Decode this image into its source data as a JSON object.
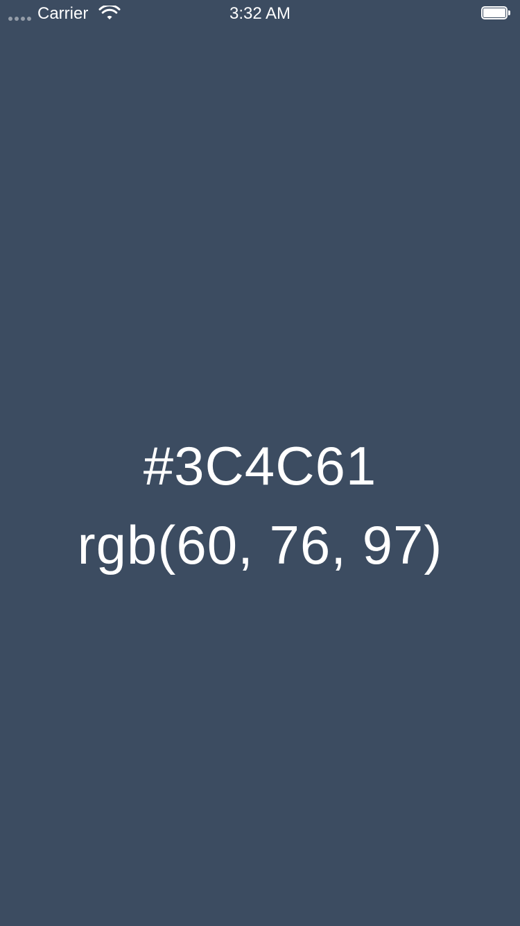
{
  "status_bar": {
    "carrier": "Carrier",
    "time": "3:32 AM",
    "wifi_icon": "wifi-icon",
    "battery_icon": "battery-icon",
    "signal_icon": "signal-dots-icon"
  },
  "color": {
    "hex": "#3C4C61",
    "rgb": "rgb(60, 76, 97)",
    "background": "#3C4C61",
    "text_color": "#FFFFFF"
  }
}
